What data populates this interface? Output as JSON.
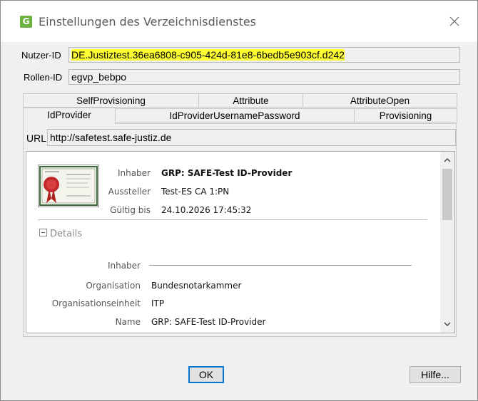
{
  "window": {
    "title": "Einstellungen des Verzeichnisdienstes",
    "app_icon_letter": "G",
    "accent": "#6db33f"
  },
  "fields": {
    "nutzer_id_label": "Nutzer-ID",
    "nutzer_id_value": "DE.Justiztest.36ea6808-c905-424d-81e8-6bedb5e903cf.d242",
    "rollen_id_label": "Rollen-ID",
    "rollen_id_value": "egvp_bebpo",
    "highlight_color": "#ffff33"
  },
  "tabs": {
    "row1": [
      "SelfProvisioning",
      "Attribute",
      "AttributeOpen"
    ],
    "row2": [
      "IdProvider",
      "IdProviderUsernamePassword",
      "Provisioning"
    ],
    "active": "IdProvider"
  },
  "url": {
    "label": "URL",
    "value": "http://safetest.safe-justiz.de"
  },
  "certificate": {
    "inhaber_label": "Inhaber",
    "inhaber_value": "GRP: SAFE-Test ID-Provider",
    "aussteller_label": "Aussteller",
    "aussteller_value": "Test-ES CA 1:PN",
    "gueltig_label": "Gültig bis",
    "gueltig_value": "24.10.2026 17:45:32"
  },
  "details": {
    "toggle_label": "Details",
    "inhaber_label": "Inhaber",
    "organisation_label": "Organisation",
    "organisation_value": "Bundesnotarkammer",
    "orgeinheit_label": "Organisationseinheit",
    "orgeinheit_value": "ITP",
    "name_label": "Name",
    "name_value": "GRP: SAFE-Test ID-Provider"
  },
  "buttons": {
    "ok": "OK",
    "help": "Hilfe..."
  }
}
